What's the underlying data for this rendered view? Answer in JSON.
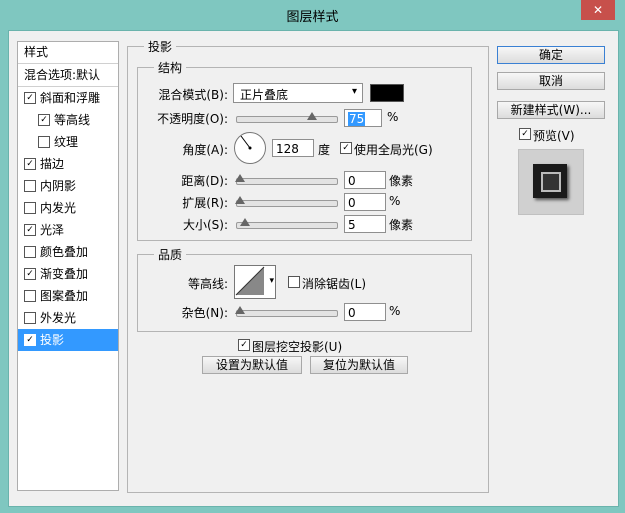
{
  "window": {
    "title": "图层样式",
    "close": "✕"
  },
  "styles": {
    "header": "样式",
    "blend_options": "混合选项:默认",
    "items": [
      {
        "label": "斜面和浮雕",
        "checked": true,
        "indent": false,
        "selected": false
      },
      {
        "label": "等高线",
        "checked": true,
        "indent": true,
        "selected": false
      },
      {
        "label": "纹理",
        "checked": false,
        "indent": true,
        "selected": false
      },
      {
        "label": "描边",
        "checked": true,
        "indent": false,
        "selected": false
      },
      {
        "label": "内阴影",
        "checked": false,
        "indent": false,
        "selected": false
      },
      {
        "label": "内发光",
        "checked": false,
        "indent": false,
        "selected": false
      },
      {
        "label": "光泽",
        "checked": true,
        "indent": false,
        "selected": false
      },
      {
        "label": "颜色叠加",
        "checked": false,
        "indent": false,
        "selected": false
      },
      {
        "label": "渐变叠加",
        "checked": true,
        "indent": false,
        "selected": false
      },
      {
        "label": "图案叠加",
        "checked": false,
        "indent": false,
        "selected": false
      },
      {
        "label": "外发光",
        "checked": false,
        "indent": false,
        "selected": false
      },
      {
        "label": "投影",
        "checked": true,
        "indent": false,
        "selected": true
      }
    ]
  },
  "drop_shadow": {
    "title": "投影",
    "structure": {
      "title": "结构",
      "blend_mode_label": "混合模式(B):",
      "blend_mode_value": "正片叠底",
      "shadow_color": "#000000",
      "opacity_label": "不透明度(O):",
      "opacity_value": "75",
      "opacity_unit": "%",
      "angle_label": "角度(A):",
      "angle_value": "128",
      "angle_unit": "度",
      "global_light_label": "使用全局光(G)",
      "global_light_checked": true,
      "distance_label": "距离(D):",
      "distance_value": "0",
      "distance_unit": "像素",
      "spread_label": "扩展(R):",
      "spread_value": "0",
      "spread_unit": "%",
      "size_label": "大小(S):",
      "size_value": "5",
      "size_unit": "像素"
    },
    "quality": {
      "title": "品质",
      "contour_label": "等高线:",
      "anti_alias_label": "消除锯齿(L)",
      "anti_alias_checked": false,
      "noise_label": "杂色(N):",
      "noise_value": "0",
      "noise_unit": "%"
    },
    "knockout_label": "图层挖空投影(U)",
    "knockout_checked": true,
    "make_default": "设置为默认值",
    "reset_default": "复位为默认值"
  },
  "buttons": {
    "ok": "确定",
    "cancel": "取消",
    "new_style": "新建样式(W)...",
    "preview_label": "预览(V)",
    "preview_checked": true
  }
}
